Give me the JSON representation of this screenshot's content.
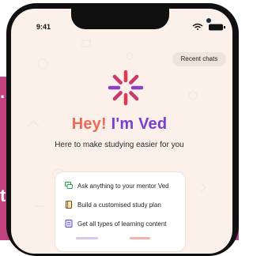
{
  "page_left_text_fragment": "t.",
  "status_bar": {
    "time": "9:41"
  },
  "header": {
    "recent_chats_label": "Recent chats"
  },
  "hero": {
    "title_part1": "Hey!",
    "title_part2": "I'm Ved",
    "subtitle": "Here to make studying easier for you"
  },
  "features": [
    {
      "label": "Ask anything to your mentor Ved",
      "icon": "chat-icon"
    },
    {
      "label": "Build a customised study plan",
      "icon": "book-icon"
    },
    {
      "label": "Get all types of learning content",
      "icon": "document-icon"
    }
  ],
  "colors": {
    "accent_orange": "#f06a5a",
    "accent_purple": "#7a3fd1",
    "logo_red": "#e2384f",
    "logo_purple": "#8a3fc7",
    "background_magenta": "#b93c8c"
  }
}
